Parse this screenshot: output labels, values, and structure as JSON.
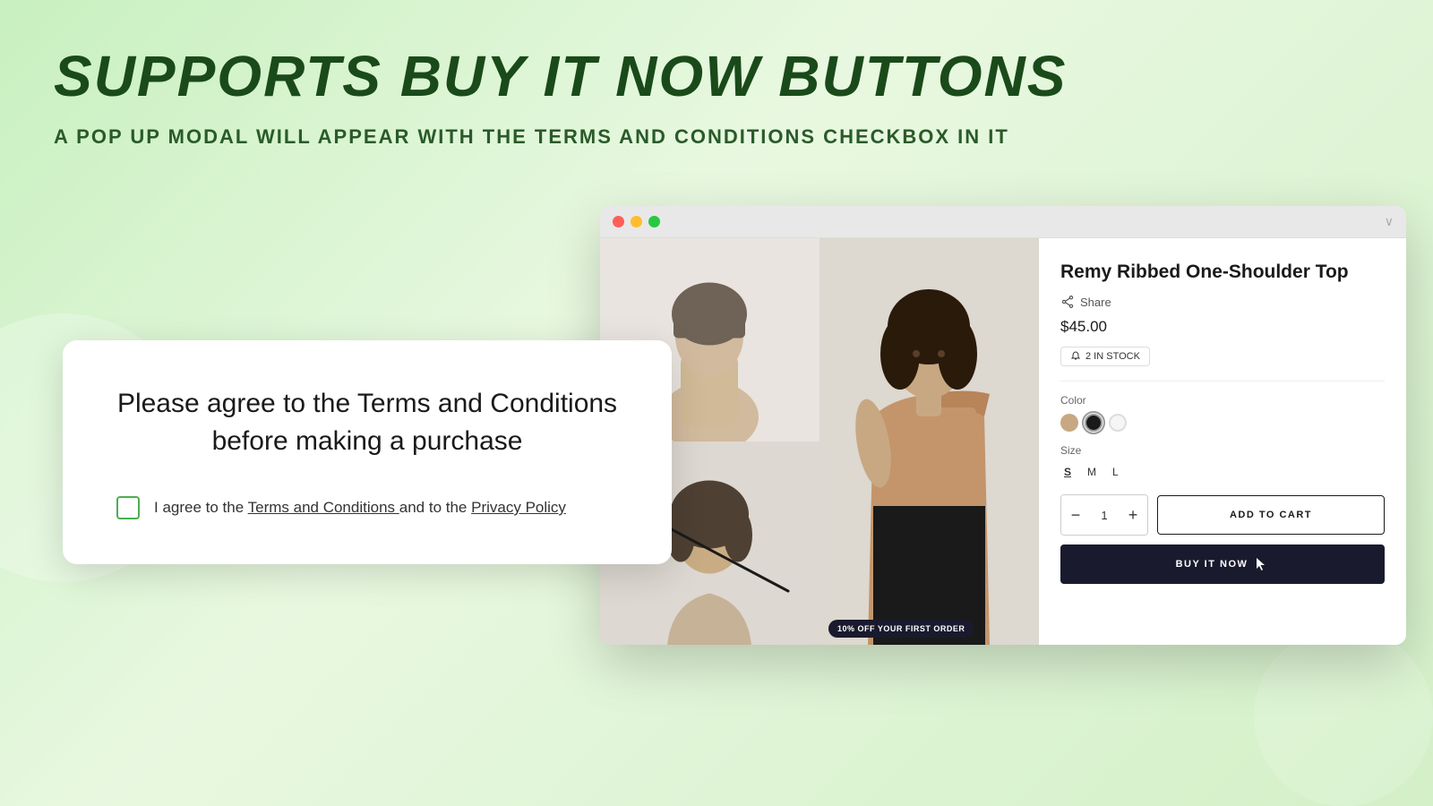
{
  "page": {
    "background_gradient_start": "#c8f0c0",
    "background_gradient_end": "#d4f0c8"
  },
  "headline": {
    "text": "SUPPORTS BUY IT NOW BUTTONS",
    "color": "#1a4a1a"
  },
  "subheadline": {
    "text": "A POP UP MODAL WILL APPEAR WITH THE TERMS AND CONDITIONS CHECKBOX IN IT",
    "color": "#2a5a2a"
  },
  "browser": {
    "dots": [
      "#ff5f57",
      "#ffbd2e",
      "#28c840"
    ],
    "chevron": "∨"
  },
  "product": {
    "title": "Remy Ribbed One-Shoulder Top",
    "share_label": "Share",
    "price": "$45.00",
    "stock": "2 IN STOCK",
    "color_label": "Color",
    "size_label": "Size",
    "sizes": [
      "S",
      "M",
      "L"
    ],
    "quantity": 1,
    "add_to_cart_label": "ADD TO CART",
    "buy_now_label": "BUY IT NOW"
  },
  "discount_badge": {
    "text": "10% OFF YOUR FIRST ORDER"
  },
  "modal": {
    "title": "Please agree to the Terms and Conditions before making a purchase",
    "checkbox_label_prefix": "I agree to the",
    "terms_link": "Terms and Conditions",
    "checkbox_label_middle": "and to the",
    "privacy_link": "Privacy Policy"
  }
}
